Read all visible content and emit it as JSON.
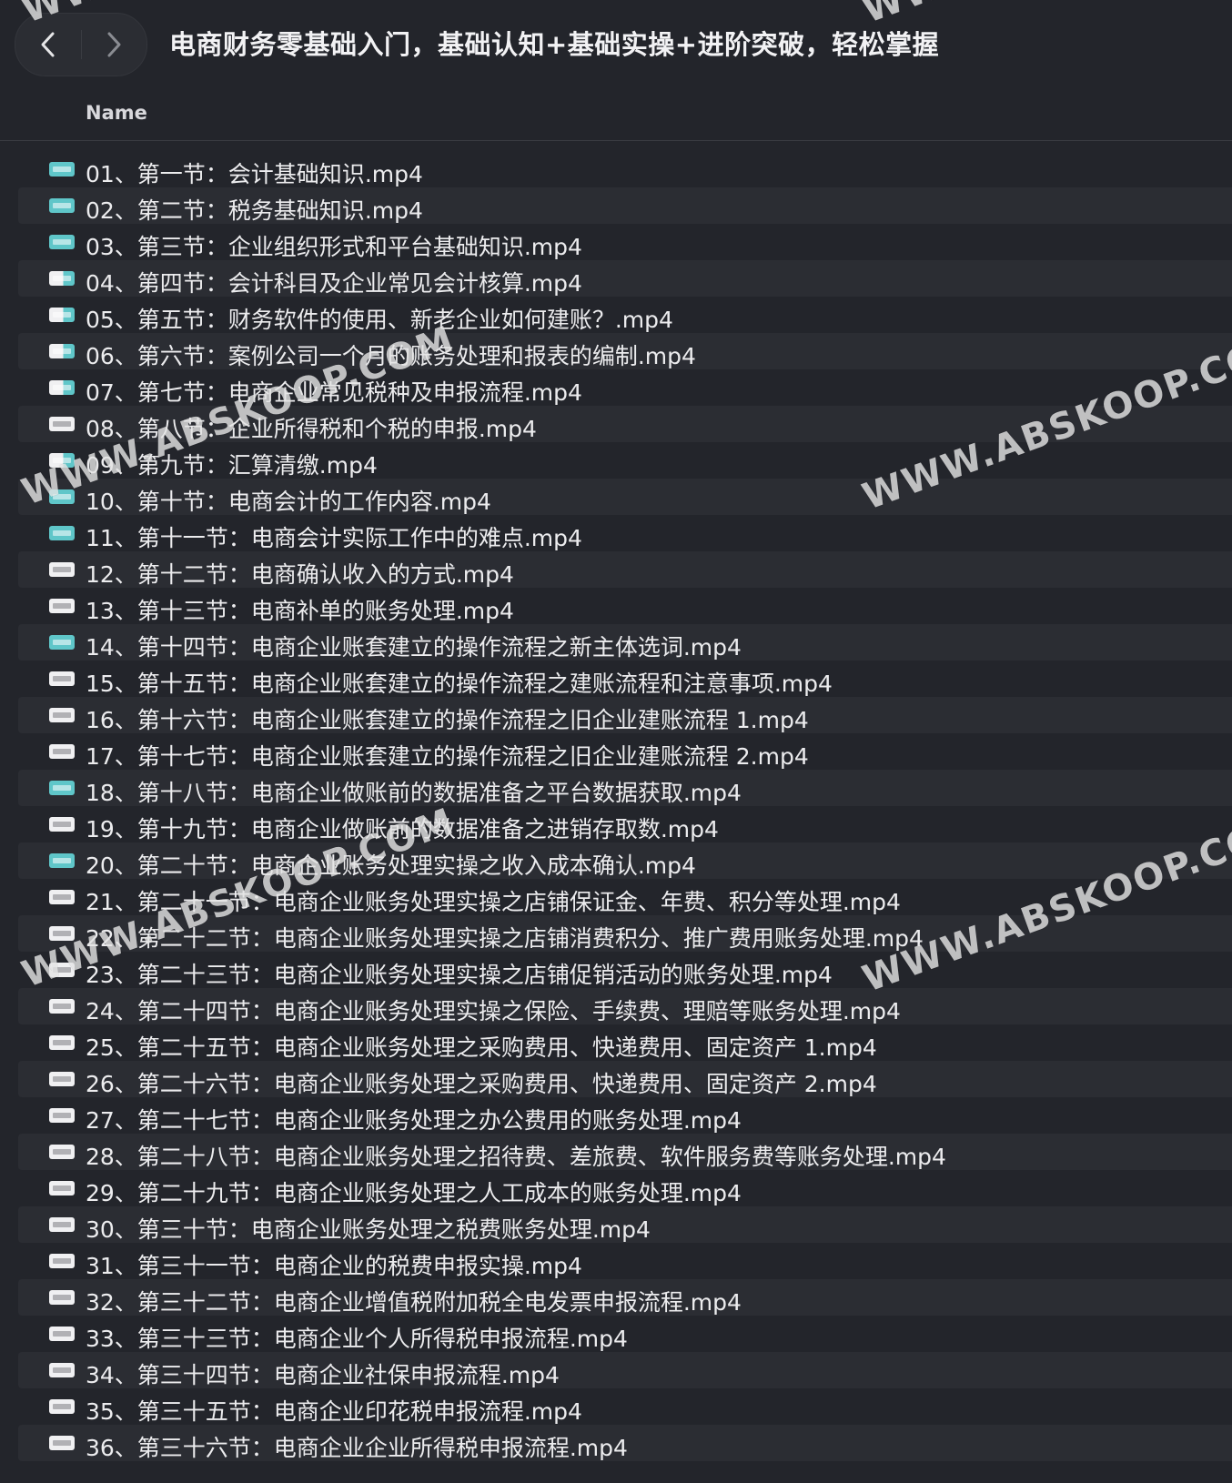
{
  "window": {
    "title": "电商财务零基础入门，基础认知+基础实操+进阶突破，轻松掌握"
  },
  "navigation": {
    "back_icon": "chevron-left-icon",
    "forward_icon": "chevron-right-icon"
  },
  "columns": {
    "name": "Name"
  },
  "files": [
    {
      "label": "01、第一节：会计基础知识.mp4",
      "icon": "teal"
    },
    {
      "label": "02、第二节：税务基础知识.mp4",
      "icon": "teal"
    },
    {
      "label": "03、第三节：企业组织形式和平台基础知识.mp4",
      "icon": "teal"
    },
    {
      "label": "04、第四节：会计科目及企业常见会计核算.mp4",
      "icon": "mixed"
    },
    {
      "label": "05、第五节：财务软件的使用、新老企业如何建账？.mp4",
      "icon": "mixed"
    },
    {
      "label": "06、第六节：案例公司一个月的账务处理和报表的编制.mp4",
      "icon": "mixed"
    },
    {
      "label": "07、第七节：电商企业常见税种及申报流程.mp4",
      "icon": "mixed"
    },
    {
      "label": "08、第八节：企业所得税和个税的申报.mp4",
      "icon": "white"
    },
    {
      "label": "09、第九节：汇算清缴.mp4",
      "icon": "mixed"
    },
    {
      "label": "10、第十节：电商会计的工作内容.mp4",
      "icon": "teal"
    },
    {
      "label": "11、第十一节：电商会计实际工作中的难点.mp4",
      "icon": "teal"
    },
    {
      "label": "12、第十二节：电商确认收入的方式.mp4",
      "icon": "white"
    },
    {
      "label": "13、第十三节：电商补单的账务处理.mp4",
      "icon": "white"
    },
    {
      "label": "14、第十四节：电商企业账套建立的操作流程之新主体选词.mp4",
      "icon": "teal"
    },
    {
      "label": "15、第十五节：电商企业账套建立的操作流程之建账流程和注意事项.mp4",
      "icon": "white"
    },
    {
      "label": "16、第十六节：电商企业账套建立的操作流程之旧企业建账流程 1.mp4",
      "icon": "white"
    },
    {
      "label": "17、第十七节：电商企业账套建立的操作流程之旧企业建账流程 2.mp4",
      "icon": "white"
    },
    {
      "label": "18、第十八节：电商企业做账前的数据准备之平台数据获取.mp4",
      "icon": "teal"
    },
    {
      "label": "19、第十九节：电商企业做账前的数据准备之进销存取数.mp4",
      "icon": "white"
    },
    {
      "label": "20、第二十节：电商企业账务处理实操之收入成本确认.mp4",
      "icon": "teal"
    },
    {
      "label": "21、第二十一节：电商企业账务处理实操之店铺保证金、年费、积分等处理.mp4",
      "icon": "white"
    },
    {
      "label": "22、第二十二节：电商企业账务处理实操之店铺消费积分、推广费用账务处理.mp4",
      "icon": "white"
    },
    {
      "label": "23、第二十三节：电商企业账务处理实操之店铺促销活动的账务处理.mp4",
      "icon": "white"
    },
    {
      "label": "24、第二十四节：电商企业账务处理实操之保险、手续费、理赔等账务处理.mp4",
      "icon": "white"
    },
    {
      "label": "25、第二十五节：电商企业账务处理之采购费用、快递费用、固定资产 1.mp4",
      "icon": "white"
    },
    {
      "label": "26、第二十六节：电商企业账务处理之采购费用、快递费用、固定资产 2.mp4",
      "icon": "white"
    },
    {
      "label": "27、第二十七节：电商企业账务处理之办公费用的账务处理.mp4",
      "icon": "white"
    },
    {
      "label": "28、第二十八节：电商企业账务处理之招待费、差旅费、软件服务费等账务处理.mp4",
      "icon": "white"
    },
    {
      "label": "29、第二十九节：电商企业账务处理之人工成本的账务处理.mp4",
      "icon": "white"
    },
    {
      "label": "30、第三十节：电商企业账务处理之税费账务处理.mp4",
      "icon": "white"
    },
    {
      "label": "31、第三十一节：电商企业的税费申报实操.mp4",
      "icon": "white"
    },
    {
      "label": "32、第三十二节：电商企业增值税附加税全电发票申报流程.mp4",
      "icon": "white"
    },
    {
      "label": "33、第三十三节：电商企业个人所得税申报流程.mp4",
      "icon": "white"
    },
    {
      "label": "34、第三十四节：电商企业社保申报流程.mp4",
      "icon": "white"
    },
    {
      "label": "35、第三十五节：电商企业印花税申报流程.mp4",
      "icon": "white"
    },
    {
      "label": "36、第三十六节：电商企业企业所得税申报流程.mp4",
      "icon": "white"
    }
  ],
  "watermark": {
    "text": "WWW.ABSKOOP.COM"
  }
}
